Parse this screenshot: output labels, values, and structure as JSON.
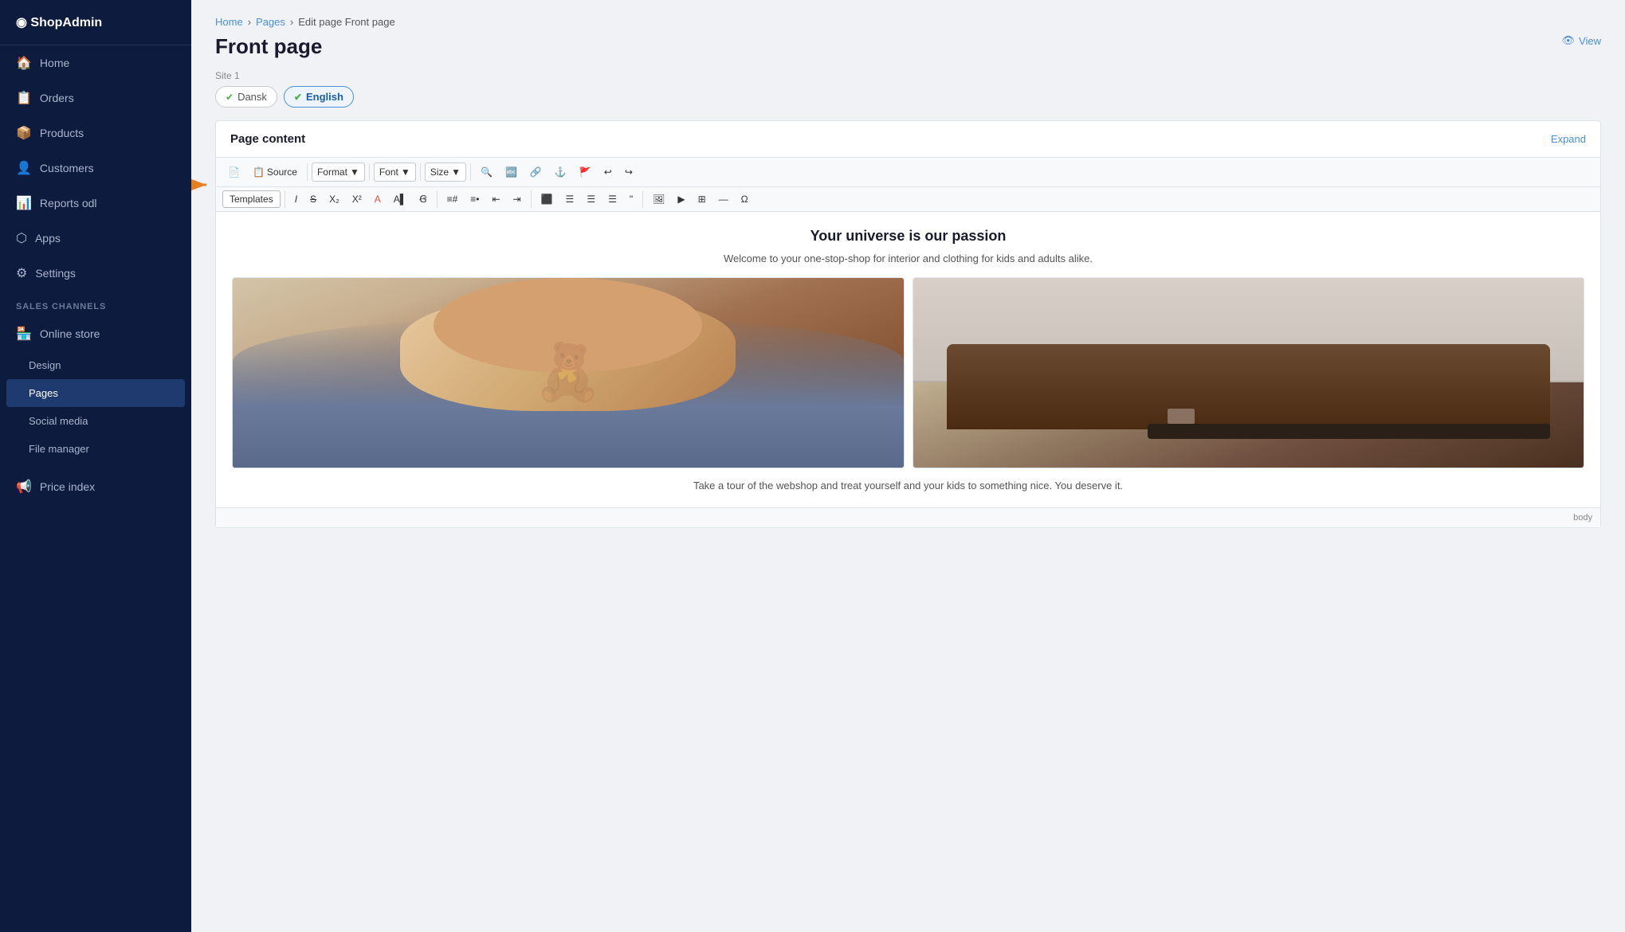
{
  "sidebar": {
    "nav_items": [
      {
        "id": "home",
        "label": "Home",
        "icon": "🏠"
      },
      {
        "id": "orders",
        "label": "Orders",
        "icon": "📋"
      },
      {
        "id": "products",
        "label": "Products",
        "icon": "📦"
      },
      {
        "id": "customers",
        "label": "Customers",
        "icon": "👤"
      },
      {
        "id": "reports",
        "label": "Reports odl",
        "icon": "📊"
      },
      {
        "id": "apps",
        "label": "Apps",
        "icon": "⬡"
      },
      {
        "id": "settings",
        "label": "Settings",
        "icon": "⚙"
      }
    ],
    "section_label": "SALES CHANNELS",
    "channel_item": {
      "id": "online-store",
      "label": "Online store",
      "icon": "🏪"
    },
    "sub_items": [
      {
        "id": "design",
        "label": "Design",
        "active": false
      },
      {
        "id": "pages",
        "label": "Pages",
        "active": true
      },
      {
        "id": "social-media",
        "label": "Social media",
        "active": false
      },
      {
        "id": "file-manager",
        "label": "File manager",
        "active": false
      }
    ],
    "extra_items": [
      {
        "id": "price-index",
        "label": "Price index",
        "icon": "📢"
      }
    ]
  },
  "breadcrumb": {
    "items": [
      "Home",
      "Pages",
      "Edit page Front page"
    ],
    "separators": [
      "›",
      "›"
    ]
  },
  "page": {
    "title": "Front page",
    "view_label": "View",
    "site_label": "Site 1"
  },
  "lang_tabs": [
    {
      "id": "dansk",
      "label": "Dansk",
      "active": false
    },
    {
      "id": "english",
      "label": "English",
      "active": true
    }
  ],
  "editor": {
    "card_title": "Page content",
    "expand_label": "Expand",
    "toolbar_row1": {
      "source_label": "Source",
      "format_label": "Format",
      "font_label": "Font",
      "size_label": "Size"
    },
    "toolbar_row2": {
      "templates_label": "Templates"
    },
    "content": {
      "headline": "Your universe is our passion",
      "subtext": "Welcome to your one-stop-shop for interior and clothing for kids and adults alike.",
      "bottom_text": "Take a tour of the webshop and treat yourself and your kids to something nice. You deserve it."
    },
    "footer_label": "body"
  },
  "arrow": {
    "color": "#e67e22"
  }
}
